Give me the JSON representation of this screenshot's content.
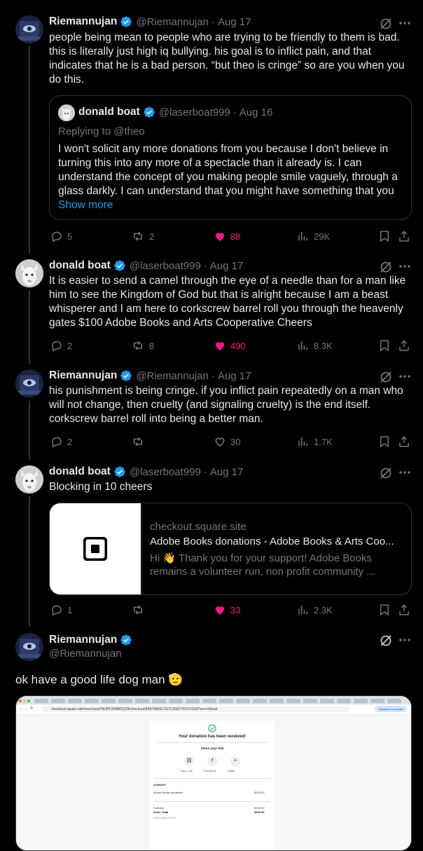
{
  "accent": "#1d9bf0",
  "like_color": "#f91880",
  "posts": [
    {
      "name": "Riemannujan",
      "handle": "@Riemannujan",
      "date": "Aug 17",
      "text_lines": [
        "people being mean to people who are trying to be friendly to them is bad.",
        "this is literally just high iq bullying. his goal is to inflict pain, and that",
        "indicates that he is a bad person. “but theo is cringe” so are you when you",
        "do this."
      ],
      "quote": {
        "name": "donald boat",
        "handle": "@laserboat999",
        "date": "Aug 16",
        "replying": "Replying to @theo",
        "text_lines": [
          "I won't solicit any more donations from you because I don't believe in",
          "turning this into any more of a spectacle than it already is. I can",
          "understand the concept of you making people smile vaguely, through a",
          "glass darkly. I can understand that you might have something that you"
        ],
        "show_more": "Show more"
      },
      "replies": "5",
      "reposts": "2",
      "likes": "88",
      "views": "29K"
    },
    {
      "name": "donald boat",
      "handle": "@laserboat999",
      "date": "Aug 17",
      "text_lines": [
        "It is easier to send a camel through the eye of a needle than for a man like",
        "him to see the Kingdom of God but that is alright because I am a beast",
        "whisperer and I am here to corkscrew barrel roll you through the heavenly",
        "gates  $100 Adobe Books and Arts Cooperative Cheers"
      ],
      "replies": "2",
      "reposts": "8",
      "likes": "490",
      "views": "8.3K"
    },
    {
      "name": "Riemannujan",
      "handle": "@Riemannujan",
      "date": "Aug 17",
      "text_lines": [
        "his punishment is being cringe. if you inflict pain repeatedly on a man who",
        "will not change, then cruelty (and signaling cruelty) is the end itself.",
        "corkscrew barrel roll into being a better man."
      ],
      "replies": "2",
      "reposts": "",
      "likes": "30",
      "views": "1.7K"
    },
    {
      "name": "donald boat",
      "handle": "@laserboat999",
      "date": "Aug 17",
      "text_lines": [
        "Blocking in 10 cheers"
      ],
      "card": {
        "domain": "checkout.square.site",
        "title": "Adobe Books donations - Adobe Books & Arts Coo...",
        "desc_line1": "Hi 👋 Thank you for your support! Adobe Books",
        "desc_line2": "remains a volunteer run, non profit community ..."
      },
      "replies": "1",
      "reposts": "",
      "likes": "33",
      "views": "2.3K"
    }
  ],
  "main_post": {
    "name": "Riemannujan",
    "handle": "@Riemannujan",
    "text": "ok have a good life dog man 🫡",
    "screenshot": {
      "url": "checkout.square.site/merchant/7MJPF32MBDQTA/checkout/3K87WASL7G7L2GN7YDF2YEW?src=chkout",
      "update_btn": "Relaunch to update",
      "received": "Your donation has been received!",
      "share": "Share your link",
      "copy": "Copy Link",
      "facebook": "Facebook",
      "twitter": "Twitter",
      "summary": "SUMMARY",
      "item": "Adobe Books donations",
      "item_price": "$100.00",
      "subtotal": "Subtotal",
      "subtotal_val": "$100.00",
      "order_total": "Order Total",
      "order_total_val": "$100.00",
      "visa": "VISA ending in 9730"
    }
  }
}
